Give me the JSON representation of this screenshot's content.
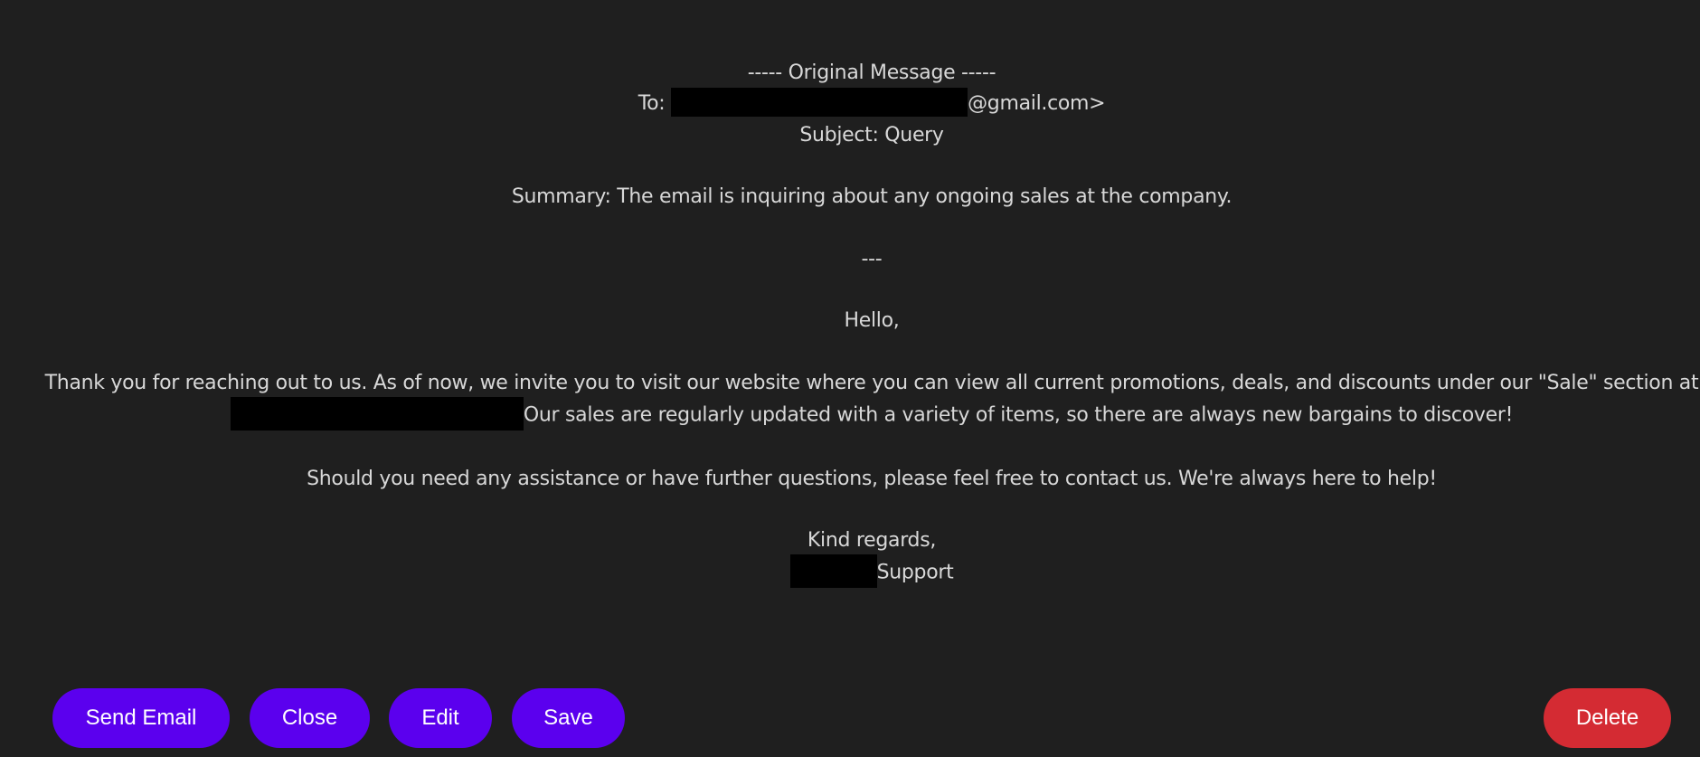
{
  "email": {
    "header_line": "----- Original Message -----",
    "to_label": "To:",
    "to_suffix": "@gmail.com>",
    "subject_line": "Subject: Query",
    "summary_line": "Summary: The email is inquiring about any ongoing sales at the company.",
    "separator": "---",
    "greeting": "Hello,",
    "body_line_1": "Thank you for reaching out to us. As of now, we invite you to visit our website where you can view all current promotions, deals, and discounts under our \"Sale\" section at",
    "body_line_2": "Our sales are regularly updated with a variety of items, so there are always new bargains to discover!",
    "assistance_line": "Should you need any assistance or have further questions, please feel free to contact us. We're always here to help!",
    "closing": "Kind regards,",
    "signature_suffix": "Support"
  },
  "actions": {
    "send_label": "Send Email",
    "close_label": "Close",
    "edit_label": "Edit",
    "save_label": "Save",
    "delete_label": "Delete"
  },
  "colors": {
    "background": "#1f1f1f",
    "text": "#d8d8d8",
    "primary_button": "#5b00ee",
    "danger_button": "#d42b33",
    "redaction": "#000000"
  }
}
